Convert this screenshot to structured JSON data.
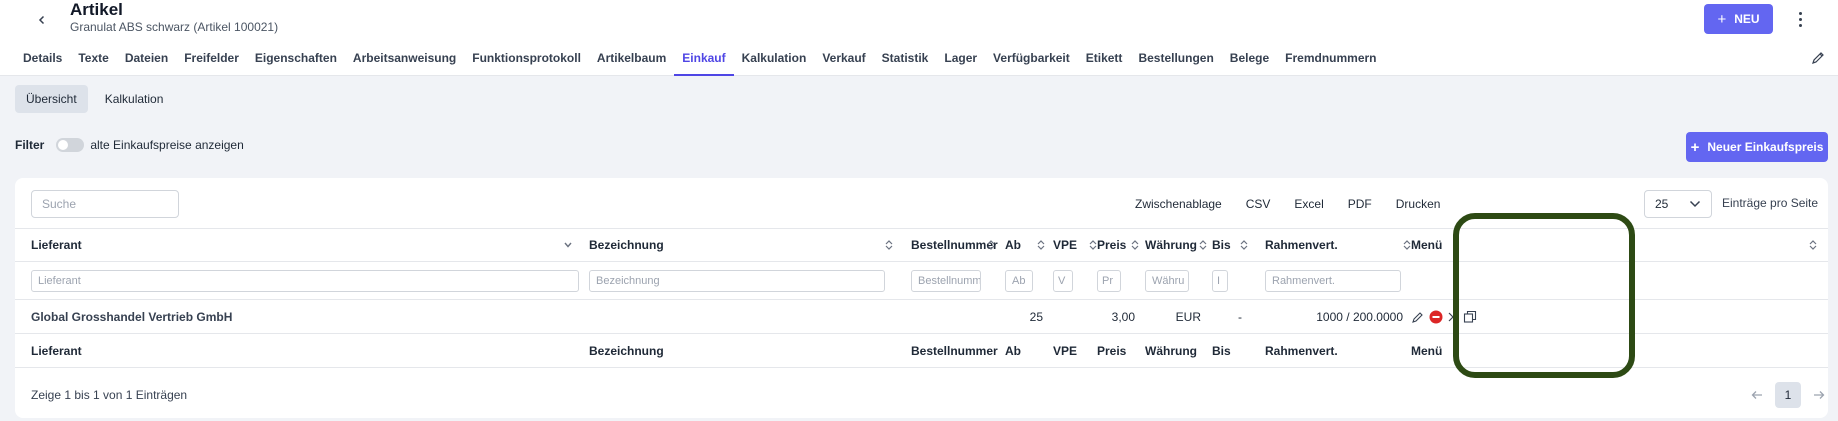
{
  "header": {
    "title": "Artikel",
    "subtitle": "Granulat ABS schwarz (Artikel 100021)",
    "new_label": "NEU"
  },
  "tabs": [
    {
      "label": "Details",
      "active": false
    },
    {
      "label": "Texte",
      "active": false
    },
    {
      "label": "Dateien",
      "active": false
    },
    {
      "label": "Freifelder",
      "active": false
    },
    {
      "label": "Eigenschaften",
      "active": false
    },
    {
      "label": "Arbeitsanweisung",
      "active": false
    },
    {
      "label": "Funktionsprotokoll",
      "active": false
    },
    {
      "label": "Artikelbaum",
      "active": false
    },
    {
      "label": "Einkauf",
      "active": true
    },
    {
      "label": "Kalkulation",
      "active": false
    },
    {
      "label": "Verkauf",
      "active": false
    },
    {
      "label": "Statistik",
      "active": false
    },
    {
      "label": "Lager",
      "active": false
    },
    {
      "label": "Verfügbarkeit",
      "active": false
    },
    {
      "label": "Etikett",
      "active": false
    },
    {
      "label": "Bestellungen",
      "active": false
    },
    {
      "label": "Belege",
      "active": false
    },
    {
      "label": "Fremdnummern",
      "active": false
    }
  ],
  "subtabs": [
    {
      "label": "Übersicht",
      "active": true
    },
    {
      "label": "Kalkulation",
      "active": false
    }
  ],
  "filter": {
    "label": "Filter",
    "toggle_label": "alte Einkaufspreise anzeigen"
  },
  "new_price_label": "Neuer Einkaufspreis",
  "table": {
    "search_placeholder": "Suche",
    "exports": [
      "Zwischenablage",
      "CSV",
      "Excel",
      "PDF",
      "Drucken"
    ],
    "page_size": "25",
    "page_size_label": "Einträge pro Seite",
    "columns": {
      "lieferant": "Lieferant",
      "bezeichnung": "Bezeichnung",
      "bestellnummer": "Bestellnummer",
      "ab": "Ab",
      "vpe": "VPE",
      "preis": "Preis",
      "waehrung": "Währung",
      "bis": "Bis",
      "rahmen": "Rahmenvert.",
      "menu": "Menü"
    },
    "filter_placeholders": {
      "lieferant": "Lieferant",
      "bezeichnung": "Bezeichnung",
      "bestellnummer": "Bestellnumme",
      "ab": "Ab",
      "vpe": "V",
      "preis": "Pr",
      "waehrung": "Währu",
      "bis": "I",
      "rahmen": "Rahmenvert."
    },
    "row": {
      "lieferant": "Global Grosshandel Vertrieb GmbH",
      "ab": "25",
      "preis": "3,00",
      "waehrung": "EUR",
      "bis": "-",
      "rahmen": "1000 / 200.0000"
    },
    "info": "Zeige 1 bis 1 von 1 Einträgen",
    "current_page": "1"
  },
  "colors": {
    "accent": "#6366f1",
    "highlight": "#2d4a14"
  }
}
